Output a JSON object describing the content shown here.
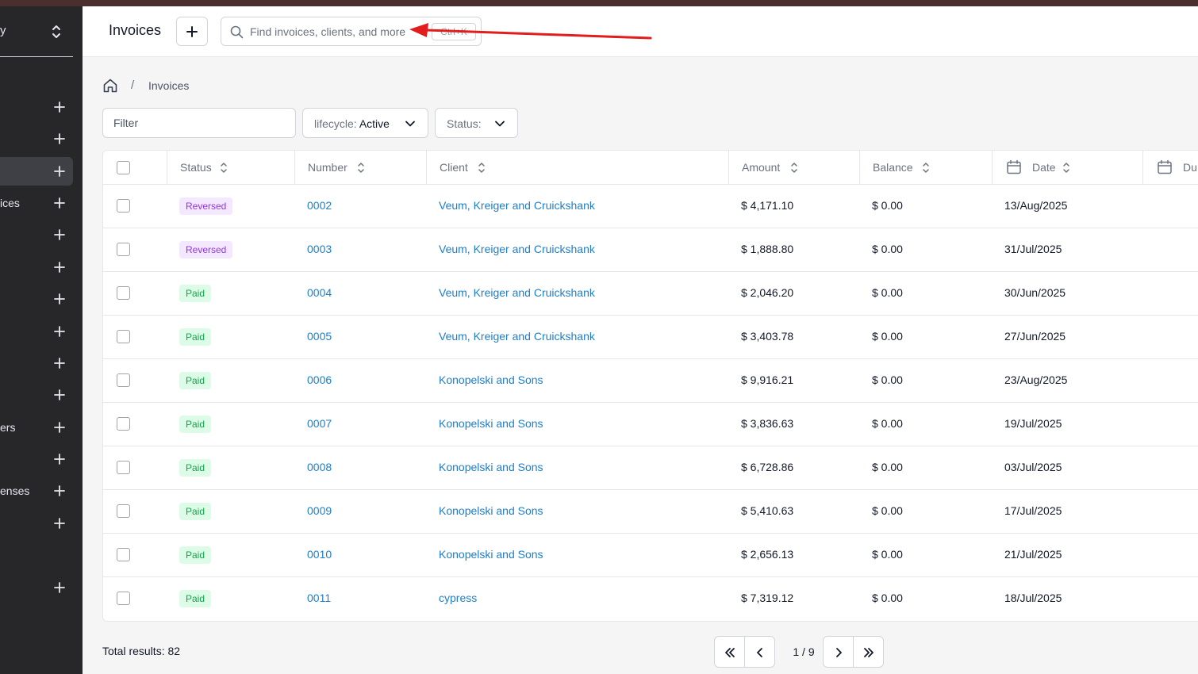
{
  "sidebar": {
    "company_name": "y",
    "items": [
      {
        "label": ""
      },
      {
        "label": ""
      },
      {
        "label": "",
        "active": true
      },
      {
        "label": "ices"
      },
      {
        "label": ""
      },
      {
        "label": ""
      },
      {
        "label": ""
      },
      {
        "label": ""
      },
      {
        "label": ""
      },
      {
        "label": ""
      },
      {
        "label": "ers"
      },
      {
        "label": ""
      },
      {
        "label": "enses"
      },
      {
        "label": ""
      },
      {
        "label": ""
      }
    ]
  },
  "header": {
    "title": "Invoices",
    "search": {
      "placeholder": "Find invoices, clients, and more",
      "shortcut": "Ctrl+K"
    }
  },
  "breadcrumb": {
    "separator": "/",
    "current": "Invoices"
  },
  "filters": {
    "filter_placeholder": "Filter",
    "lifecycle": {
      "label": "lifecycle:",
      "value": "Active"
    },
    "status": {
      "label": "Status:",
      "value": ""
    }
  },
  "table": {
    "columns": [
      "Status",
      "Number",
      "Client",
      "Amount",
      "Balance",
      "Date",
      "Du"
    ],
    "rows": [
      {
        "status": "Reversed",
        "number": "0002",
        "client": "Veum, Kreiger and Cruickshank",
        "amount": "$ 4,171.10",
        "balance": "$ 0.00",
        "date": "13/Aug/2025"
      },
      {
        "status": "Reversed",
        "number": "0003",
        "client": "Veum, Kreiger and Cruickshank",
        "amount": "$ 1,888.80",
        "balance": "$ 0.00",
        "date": "31/Jul/2025"
      },
      {
        "status": "Paid",
        "number": "0004",
        "client": "Veum, Kreiger and Cruickshank",
        "amount": "$ 2,046.20",
        "balance": "$ 0.00",
        "date": "30/Jun/2025"
      },
      {
        "status": "Paid",
        "number": "0005",
        "client": "Veum, Kreiger and Cruickshank",
        "amount": "$ 3,403.78",
        "balance": "$ 0.00",
        "date": "27/Jun/2025"
      },
      {
        "status": "Paid",
        "number": "0006",
        "client": "Konopelski and Sons",
        "amount": "$ 9,916.21",
        "balance": "$ 0.00",
        "date": "23/Aug/2025"
      },
      {
        "status": "Paid",
        "number": "0007",
        "client": "Konopelski and Sons",
        "amount": "$ 3,836.63",
        "balance": "$ 0.00",
        "date": "19/Jul/2025"
      },
      {
        "status": "Paid",
        "number": "0008",
        "client": "Konopelski and Sons",
        "amount": "$ 6,728.86",
        "balance": "$ 0.00",
        "date": "03/Jul/2025"
      },
      {
        "status": "Paid",
        "number": "0009",
        "client": "Konopelski and Sons",
        "amount": "$ 5,410.63",
        "balance": "$ 0.00",
        "date": "17/Jul/2025"
      },
      {
        "status": "Paid",
        "number": "0010",
        "client": "Konopelski and Sons",
        "amount": "$ 2,656.13",
        "balance": "$ 0.00",
        "date": "21/Jul/2025"
      },
      {
        "status": "Paid",
        "number": "0011",
        "client": "cypress",
        "amount": "$ 7,319.12",
        "balance": "$ 0.00",
        "date": "18/Jul/2025"
      }
    ]
  },
  "footer": {
    "total_results": "Total results: 82",
    "page": "1 / 9"
  },
  "icons": {
    "search": "search-icon",
    "new": "plus-icon",
    "home": "home-icon",
    "sort": "sort-icon",
    "calendar": "calendar-icon",
    "chevron": "chevron-down-icon",
    "first": "chevrons-left-icon",
    "prev": "chevron-left-icon",
    "next": "chevron-right-icon",
    "last": "chevrons-right-icon"
  },
  "colors": {
    "sidebar": "#27272a",
    "link": "#1e7ec8",
    "paid": "#16a34a",
    "reversed": "#9333ea",
    "annotation": "#e11d1d"
  }
}
